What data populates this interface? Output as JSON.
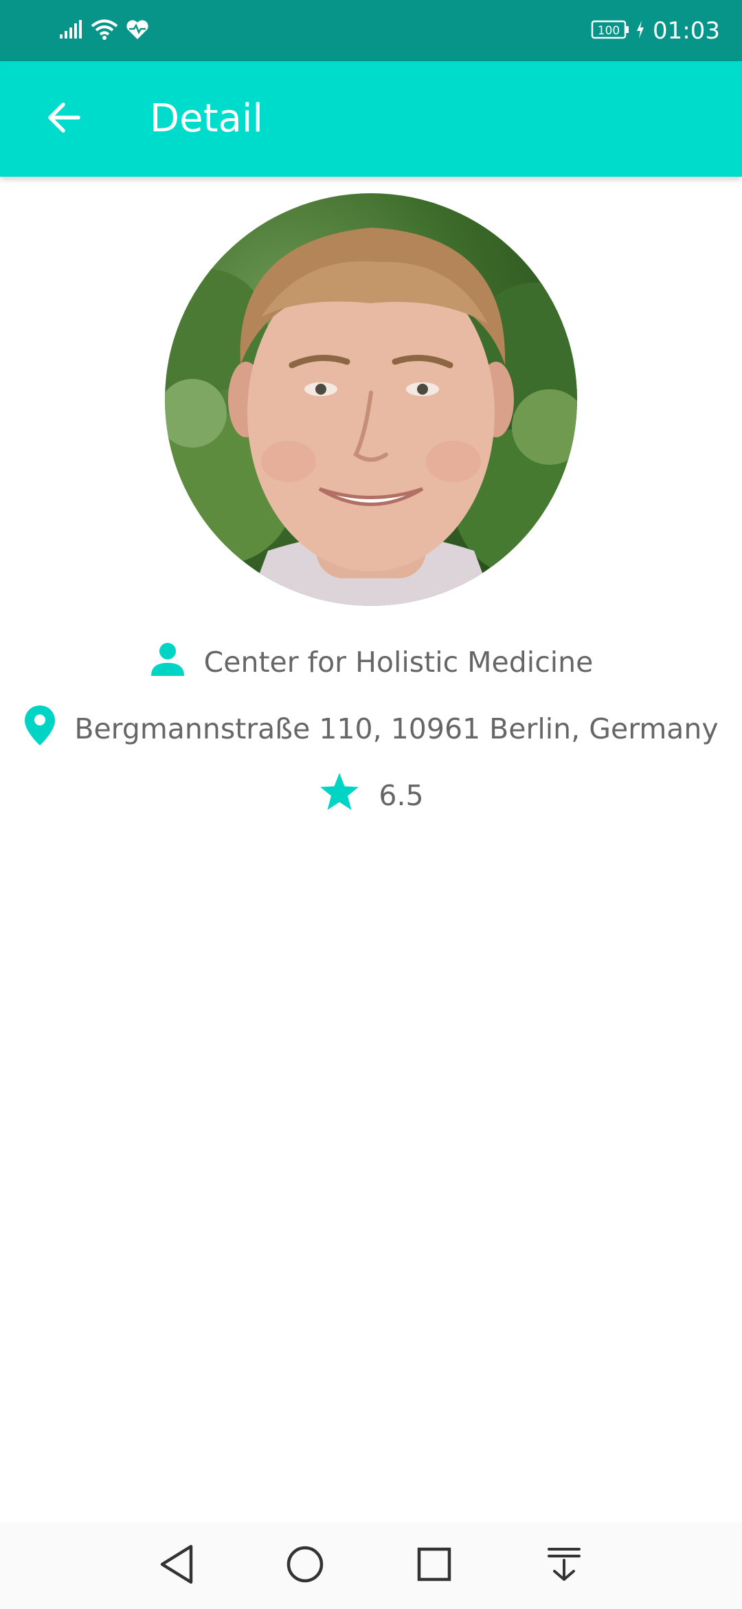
{
  "status_bar": {
    "time": "01:03",
    "battery": "100",
    "icons": [
      "signal-icon",
      "wifi-icon",
      "health-icon",
      "battery-icon",
      "charging-icon"
    ]
  },
  "app_bar": {
    "title": "Detail",
    "back_icon": "arrow-back-icon",
    "color": "#00dccb"
  },
  "profile": {
    "name": "Center for Holistic Medicine",
    "address": "Bergmannstraße 110, 10961 Berlin, Germany",
    "rating": "6.5",
    "icons": {
      "name": "person-icon",
      "address": "location-pin-icon",
      "rating": "star-icon"
    },
    "accent_color": "#00d4c4"
  },
  "nav_bar": {
    "buttons": [
      "back-triangle-icon",
      "home-circle-icon",
      "recents-square-icon",
      "notification-pull-icon"
    ]
  }
}
